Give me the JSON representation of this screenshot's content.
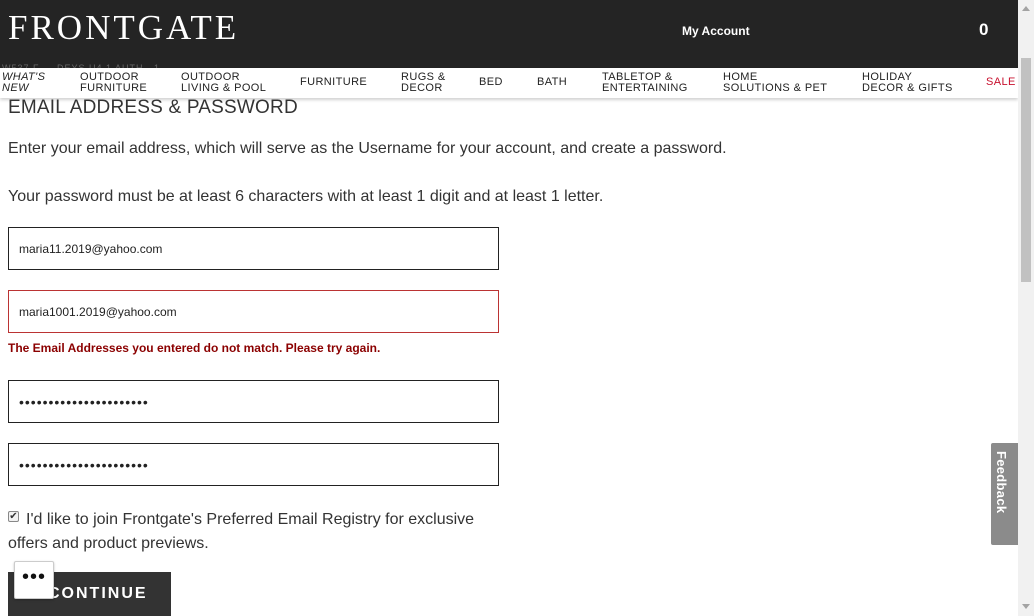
{
  "header": {
    "logo": "FRONTGATE",
    "account_label": "My Account",
    "cart_count": "0",
    "promo_peek": "W537 F  ...  DEYS  U4  1  AUTH...1"
  },
  "nav": {
    "items": [
      {
        "label": "WHAT'S\nNEW",
        "style": "italic"
      },
      {
        "label": "OUTDOOR\nFURNITURE"
      },
      {
        "label": "OUTDOOR\nLIVING & POOL"
      },
      {
        "label": "FURNITURE"
      },
      {
        "label": "RUGS &\nDECOR"
      },
      {
        "label": "BED"
      },
      {
        "label": "BATH"
      },
      {
        "label": "TABLETOP &\nENTERTAINING"
      },
      {
        "label": "HOME\nSOLUTIONS & PET"
      },
      {
        "label": "HOLIDAY\nDECOR & GIFTS"
      },
      {
        "label": "SALE",
        "style": "sale"
      }
    ]
  },
  "form": {
    "heading": "EMAIL ADDRESS & PASSWORD",
    "intro": "Enter your email address, which will serve as the Username for your account, and create a password.",
    "password_rule": "Your password must be at least 6 characters with at least 1 digit and at least 1 letter.",
    "email_value": "maria11.2019@yahoo.com",
    "confirm_email_value": "maria1001.2019@yahoo.com",
    "email_error": "The Email Addresses you entered do not match. Please try again.",
    "password_mask": "••••••••••••••••••••••",
    "confirm_password_mask": "••••••••••••••••••••••",
    "optin_checked": true,
    "optin_line1": "I'd like to join Frontgate's Preferred Email Registry for exclusive",
    "optin_line2": "offers and product previews.",
    "continue_label": "CONTINUE"
  },
  "widgets": {
    "more_label": "•••",
    "feedback_label": "Feedback",
    "feedback_icon": "feedback-icon"
  },
  "colors": {
    "header_bg": "#242424",
    "error": "#8b0000",
    "sale": "#c8102e",
    "button_bg": "#333333"
  }
}
